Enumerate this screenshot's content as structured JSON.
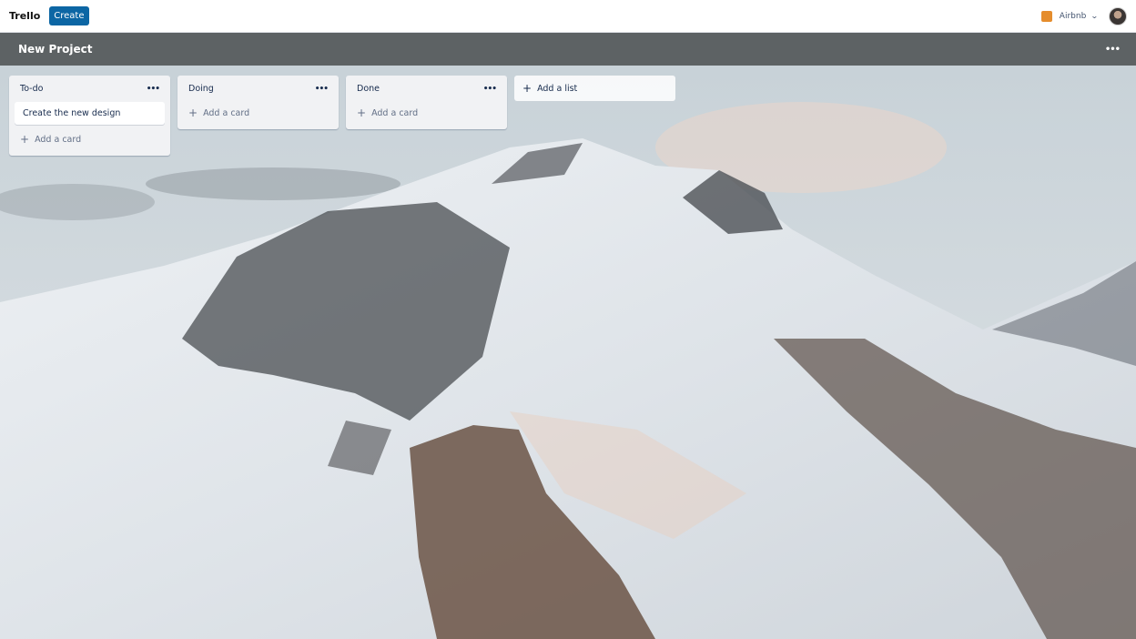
{
  "topbar": {
    "logo": "Trello",
    "create_label": "Create",
    "workspace": {
      "name": "Airbnb",
      "color": "#e58d2d"
    },
    "avatar_label": "user-avatar"
  },
  "board": {
    "title": "New Project",
    "menu_label": "..."
  },
  "lists": [
    {
      "title": "To-do",
      "menu_label": "...",
      "cards": [
        "Create the new design"
      ],
      "add_card_label": "Add a card"
    },
    {
      "title": "Doing",
      "menu_label": "...",
      "cards": [],
      "add_card_label": "Add a card"
    },
    {
      "title": "Done",
      "menu_label": "...",
      "cards": [],
      "add_card_label": "Add a card"
    }
  ],
  "add_list_label": "Add a list",
  "icons": {
    "plus": "+",
    "chevron": "⌄",
    "more": "•••"
  },
  "colors": {
    "accent": "#0c66a4",
    "boardbar": "#5d6264"
  }
}
